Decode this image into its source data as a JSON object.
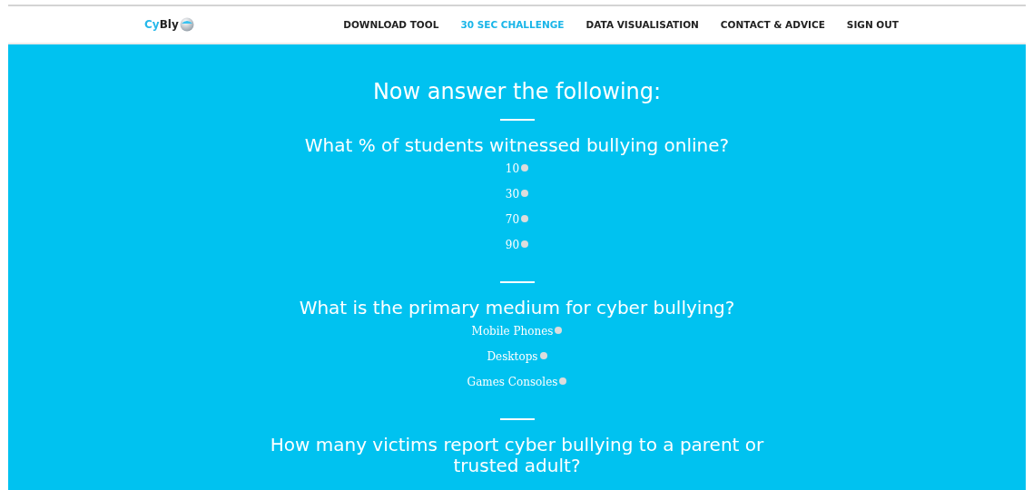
{
  "logo": {
    "accent": "Cy",
    "rest": "Bly"
  },
  "nav": [
    {
      "label": "DOWNLOAD TOOL",
      "selected": false
    },
    {
      "label": "30 SEC CHALLENGE",
      "selected": true
    },
    {
      "label": "DATA VISUALISATION",
      "selected": false
    },
    {
      "label": "CONTACT & ADVICE",
      "selected": false
    },
    {
      "label": "SIGN OUT",
      "selected": false
    }
  ],
  "heading": "Now answer the following:",
  "questions": [
    {
      "text": "What % of students witnessed bullying online?",
      "options": [
        {
          "label": "10",
          "selected": false
        },
        {
          "label": "30",
          "selected": false
        },
        {
          "label": "70",
          "selected": false
        },
        {
          "label": "90",
          "selected": false
        }
      ]
    },
    {
      "text": "What is the primary medium for cyber bullying?",
      "options": [
        {
          "label": "Mobile Phones",
          "selected": false
        },
        {
          "label": "Desktops",
          "selected": false
        },
        {
          "label": "Games Consoles",
          "selected": false
        }
      ]
    },
    {
      "text": "How many victims report cyber bullying to a parent or trusted adult?"
    }
  ]
}
